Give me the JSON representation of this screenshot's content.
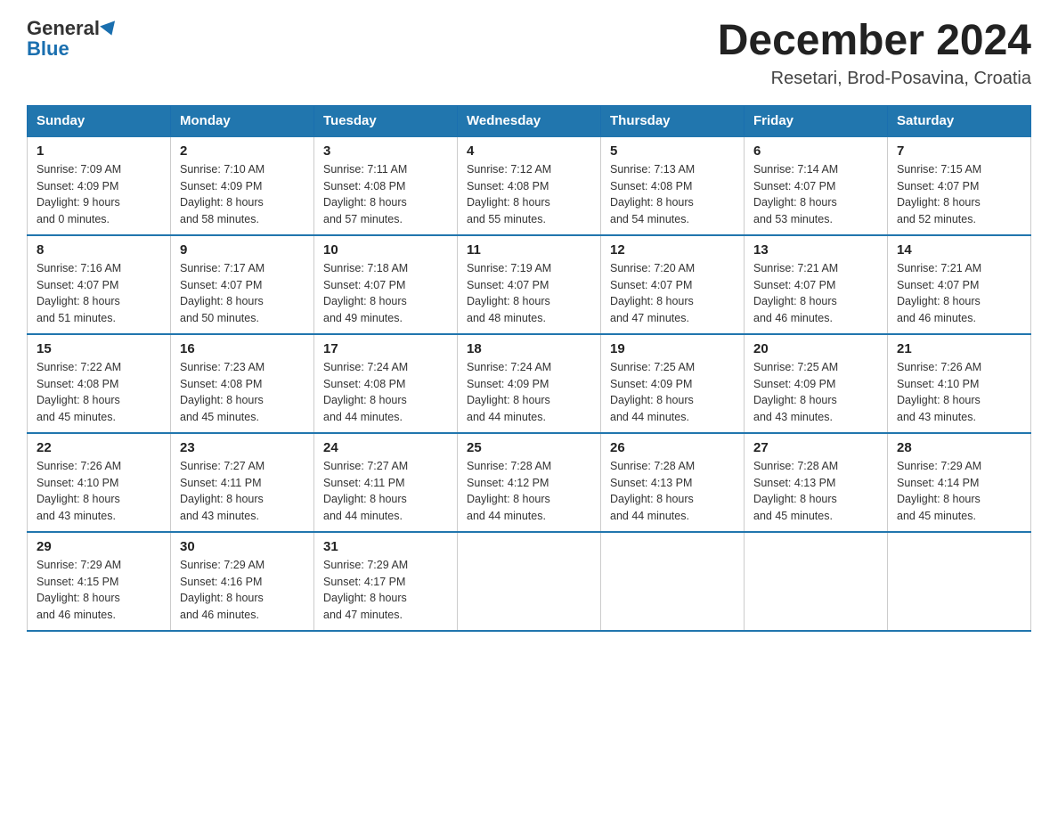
{
  "header": {
    "logo_line1": "General",
    "logo_line2": "Blue",
    "month_title": "December 2024",
    "subtitle": "Resetari, Brod-Posavina, Croatia"
  },
  "days_of_week": [
    "Sunday",
    "Monday",
    "Tuesday",
    "Wednesday",
    "Thursday",
    "Friday",
    "Saturday"
  ],
  "weeks": [
    [
      {
        "day": "1",
        "info": "Sunrise: 7:09 AM\nSunset: 4:09 PM\nDaylight: 9 hours\nand 0 minutes."
      },
      {
        "day": "2",
        "info": "Sunrise: 7:10 AM\nSunset: 4:09 PM\nDaylight: 8 hours\nand 58 minutes."
      },
      {
        "day": "3",
        "info": "Sunrise: 7:11 AM\nSunset: 4:08 PM\nDaylight: 8 hours\nand 57 minutes."
      },
      {
        "day": "4",
        "info": "Sunrise: 7:12 AM\nSunset: 4:08 PM\nDaylight: 8 hours\nand 55 minutes."
      },
      {
        "day": "5",
        "info": "Sunrise: 7:13 AM\nSunset: 4:08 PM\nDaylight: 8 hours\nand 54 minutes."
      },
      {
        "day": "6",
        "info": "Sunrise: 7:14 AM\nSunset: 4:07 PM\nDaylight: 8 hours\nand 53 minutes."
      },
      {
        "day": "7",
        "info": "Sunrise: 7:15 AM\nSunset: 4:07 PM\nDaylight: 8 hours\nand 52 minutes."
      }
    ],
    [
      {
        "day": "8",
        "info": "Sunrise: 7:16 AM\nSunset: 4:07 PM\nDaylight: 8 hours\nand 51 minutes."
      },
      {
        "day": "9",
        "info": "Sunrise: 7:17 AM\nSunset: 4:07 PM\nDaylight: 8 hours\nand 50 minutes."
      },
      {
        "day": "10",
        "info": "Sunrise: 7:18 AM\nSunset: 4:07 PM\nDaylight: 8 hours\nand 49 minutes."
      },
      {
        "day": "11",
        "info": "Sunrise: 7:19 AM\nSunset: 4:07 PM\nDaylight: 8 hours\nand 48 minutes."
      },
      {
        "day": "12",
        "info": "Sunrise: 7:20 AM\nSunset: 4:07 PM\nDaylight: 8 hours\nand 47 minutes."
      },
      {
        "day": "13",
        "info": "Sunrise: 7:21 AM\nSunset: 4:07 PM\nDaylight: 8 hours\nand 46 minutes."
      },
      {
        "day": "14",
        "info": "Sunrise: 7:21 AM\nSunset: 4:07 PM\nDaylight: 8 hours\nand 46 minutes."
      }
    ],
    [
      {
        "day": "15",
        "info": "Sunrise: 7:22 AM\nSunset: 4:08 PM\nDaylight: 8 hours\nand 45 minutes."
      },
      {
        "day": "16",
        "info": "Sunrise: 7:23 AM\nSunset: 4:08 PM\nDaylight: 8 hours\nand 45 minutes."
      },
      {
        "day": "17",
        "info": "Sunrise: 7:24 AM\nSunset: 4:08 PM\nDaylight: 8 hours\nand 44 minutes."
      },
      {
        "day": "18",
        "info": "Sunrise: 7:24 AM\nSunset: 4:09 PM\nDaylight: 8 hours\nand 44 minutes."
      },
      {
        "day": "19",
        "info": "Sunrise: 7:25 AM\nSunset: 4:09 PM\nDaylight: 8 hours\nand 44 minutes."
      },
      {
        "day": "20",
        "info": "Sunrise: 7:25 AM\nSunset: 4:09 PM\nDaylight: 8 hours\nand 43 minutes."
      },
      {
        "day": "21",
        "info": "Sunrise: 7:26 AM\nSunset: 4:10 PM\nDaylight: 8 hours\nand 43 minutes."
      }
    ],
    [
      {
        "day": "22",
        "info": "Sunrise: 7:26 AM\nSunset: 4:10 PM\nDaylight: 8 hours\nand 43 minutes."
      },
      {
        "day": "23",
        "info": "Sunrise: 7:27 AM\nSunset: 4:11 PM\nDaylight: 8 hours\nand 43 minutes."
      },
      {
        "day": "24",
        "info": "Sunrise: 7:27 AM\nSunset: 4:11 PM\nDaylight: 8 hours\nand 44 minutes."
      },
      {
        "day": "25",
        "info": "Sunrise: 7:28 AM\nSunset: 4:12 PM\nDaylight: 8 hours\nand 44 minutes."
      },
      {
        "day": "26",
        "info": "Sunrise: 7:28 AM\nSunset: 4:13 PM\nDaylight: 8 hours\nand 44 minutes."
      },
      {
        "day": "27",
        "info": "Sunrise: 7:28 AM\nSunset: 4:13 PM\nDaylight: 8 hours\nand 45 minutes."
      },
      {
        "day": "28",
        "info": "Sunrise: 7:29 AM\nSunset: 4:14 PM\nDaylight: 8 hours\nand 45 minutes."
      }
    ],
    [
      {
        "day": "29",
        "info": "Sunrise: 7:29 AM\nSunset: 4:15 PM\nDaylight: 8 hours\nand 46 minutes."
      },
      {
        "day": "30",
        "info": "Sunrise: 7:29 AM\nSunset: 4:16 PM\nDaylight: 8 hours\nand 46 minutes."
      },
      {
        "day": "31",
        "info": "Sunrise: 7:29 AM\nSunset: 4:17 PM\nDaylight: 8 hours\nand 47 minutes."
      },
      {
        "day": "",
        "info": ""
      },
      {
        "day": "",
        "info": ""
      },
      {
        "day": "",
        "info": ""
      },
      {
        "day": "",
        "info": ""
      }
    ]
  ]
}
